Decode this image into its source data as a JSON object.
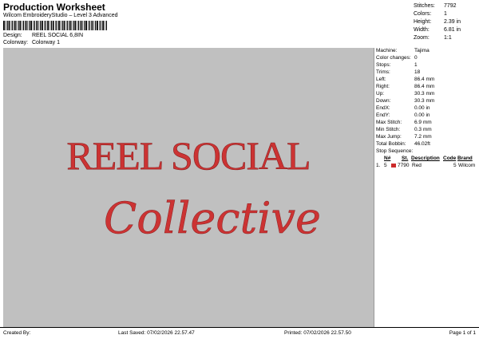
{
  "header": {
    "title": "Production Worksheet",
    "subtitle": "Wilcom EmbroideryStudio – Level 3 Advanced",
    "design_label": "Design:",
    "design_value": "REEL SOCIAL 6,8IN",
    "colorway_label": "Colorway:",
    "colorway_value": "Colorway 1"
  },
  "stats": [
    {
      "label": "Stitches:",
      "value": "7792"
    },
    {
      "label": "Colors:",
      "value": "1"
    },
    {
      "label": "Height:",
      "value": "2.39 in"
    },
    {
      "label": "Width:",
      "value": "6.81 in"
    },
    {
      "label": "Zoom:",
      "value": "1:1"
    }
  ],
  "design_text": {
    "line1": "REEL SOCIAL",
    "line2": "Collective",
    "color": "#cc3333",
    "background": "#c0c0c0"
  },
  "machine_info": [
    {
      "label": "Machine:",
      "value": "Tajima"
    },
    {
      "label": "Color changes:",
      "value": "0"
    },
    {
      "label": "Stops:",
      "value": "1"
    },
    {
      "label": "Trims:",
      "value": "18"
    },
    {
      "label": "Left:",
      "value": "86.4 mm"
    },
    {
      "label": "Right:",
      "value": "86.4 mm"
    },
    {
      "label": "Up:",
      "value": "30.3 mm"
    },
    {
      "label": "Down:",
      "value": "30.3 mm"
    },
    {
      "label": "EndX:",
      "value": "0.00 in"
    },
    {
      "label": "EndY:",
      "value": "0.00 in"
    },
    {
      "label": "Max Stitch:",
      "value": "6.9 mm"
    },
    {
      "label": "Min Stitch:",
      "value": "0.3 mm"
    },
    {
      "label": "Max Jump:",
      "value": "7.2 mm"
    },
    {
      "label": "Total Bobbin:",
      "value": "46.02ft"
    }
  ],
  "stop_sequence": {
    "title": "Stop Sequence:",
    "columns": {
      "num": "N#",
      "st": "St.",
      "desc": "Description",
      "code": "Code",
      "brand": "Brand"
    },
    "rows": [
      {
        "index": "1.",
        "num": "5",
        "st": "7790",
        "desc": "Red",
        "code": "5",
        "brand": "Wilcom",
        "color": "#cc2b2b"
      }
    ]
  },
  "footer": {
    "created_by": "Created By:",
    "last_saved": "Last Saved: 07/02/2026 22.57.47",
    "printed": "Printed: 07/02/2026 22.57.50",
    "page": "Page 1 of 1"
  }
}
